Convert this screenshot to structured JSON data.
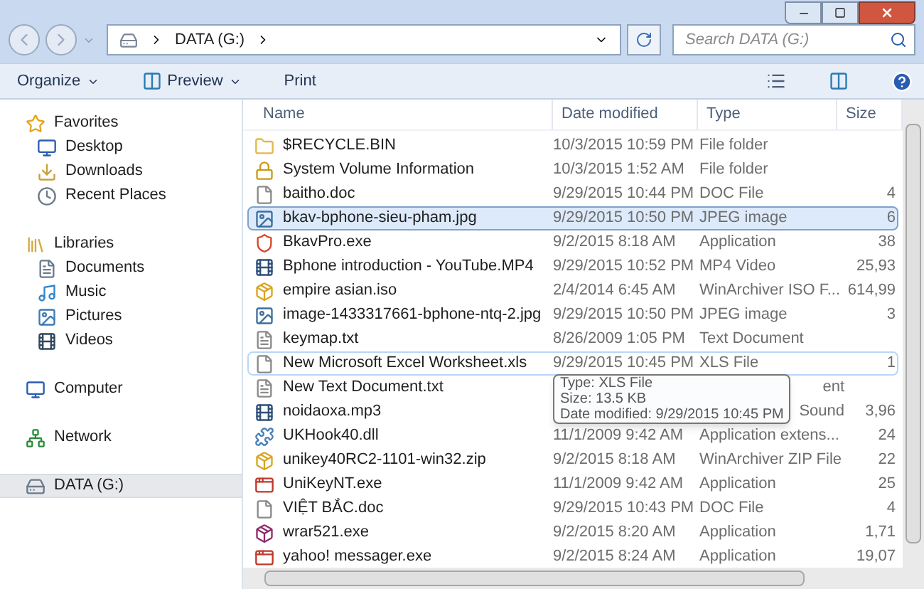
{
  "address": {
    "crumbs": [
      "DATA (G:)"
    ]
  },
  "search": {
    "placeholder": "Search DATA (G:)"
  },
  "toolbar": {
    "buttons": [
      {
        "label": "Organize",
        "kind": "menu"
      },
      {
        "label": "Preview",
        "kind": "preview"
      },
      {
        "label": "Print",
        "kind": "plain"
      }
    ]
  },
  "sidebar": {
    "groups": [
      {
        "label": "Favorites",
        "kind": "star",
        "selected": false,
        "children": [
          {
            "label": "Desktop",
            "kind": "desktop",
            "selected": false
          },
          {
            "label": "Downloads",
            "kind": "downloads",
            "selected": false
          },
          {
            "label": "Recent Places",
            "kind": "recent",
            "selected": false
          }
        ]
      },
      {
        "label": "Libraries",
        "kind": "library",
        "selected": false,
        "children": [
          {
            "label": "Documents",
            "kind": "document",
            "selected": false
          },
          {
            "label": "Music",
            "kind": "music",
            "selected": false
          },
          {
            "label": "Pictures",
            "kind": "picture",
            "selected": false
          },
          {
            "label": "Videos",
            "kind": "video",
            "selected": false
          }
        ]
      },
      {
        "label": "Computer",
        "kind": "computer",
        "selected": false
      },
      {
        "label": "Network",
        "kind": "network",
        "selected": false
      },
      {
        "label": "DATA (G:)",
        "kind": "drive",
        "selected": true
      }
    ]
  },
  "table": {
    "columns": [
      "Name",
      "Date modified",
      "Type",
      "Size"
    ],
    "rows": [
      {
        "kind": "folder",
        "name": "$RECYCLE.BIN",
        "date": "10/3/2015 10:59 PM",
        "type": "File folder",
        "selected": false,
        "hovered": false
      },
      {
        "kind": "locked",
        "name": "System Volume Information",
        "date": "10/3/2015 1:52 AM",
        "type": "File folder",
        "selected": false,
        "hovered": false
      },
      {
        "kind": "doc",
        "name": "baitho.doc",
        "date": "9/29/2015 10:44 PM",
        "type": "DOC File",
        "size": "4",
        "selected": false,
        "hovered": false
      },
      {
        "kind": "image",
        "name": "bkav-bphone-sieu-pham.jpg",
        "date": "9/29/2015 10:50 PM",
        "type": "JPEG image",
        "size": "6",
        "selected": true,
        "hovered": false
      },
      {
        "kind": "shield",
        "name": "BkavPro.exe",
        "date": "9/2/2015 8:18 AM",
        "type": "Application",
        "size": "38",
        "selected": false,
        "hovered": false
      },
      {
        "kind": "media",
        "name": "Bphone introduction - YouTube.MP4",
        "date": "9/29/2015 10:52 PM",
        "type": "MP4 Video",
        "size": "25,93",
        "selected": false,
        "hovered": false
      },
      {
        "kind": "archive",
        "name": "empire asian.iso",
        "date": "2/4/2014 6:45 AM",
        "type": "WinArchiver ISO F...",
        "size": "614,99",
        "selected": false,
        "hovered": false
      },
      {
        "kind": "image",
        "name": "image-1433317661-bphone-ntq-2.jpg",
        "date": "9/29/2015 10:50 PM",
        "type": "JPEG image",
        "size": "3",
        "selected": false,
        "hovered": false
      },
      {
        "kind": "text",
        "name": "keymap.txt",
        "date": "8/26/2009 1:05 PM",
        "type": "Text Document",
        "selected": false,
        "hovered": false
      },
      {
        "kind": "doc",
        "name": "New Microsoft Excel Worksheet.xls",
        "date": "9/29/2015 10:45 PM",
        "type": "XLS File",
        "size": "1",
        "selected": false,
        "hovered": true
      },
      {
        "kind": "text",
        "name": "New Text Document.txt",
        "type": "ent",
        "selected": false,
        "hovered": false
      },
      {
        "kind": "media",
        "name": "noidaoxa.mp3",
        "type": "Sound",
        "size": "3,96",
        "selected": false,
        "hovered": false
      },
      {
        "kind": "dll",
        "name": "UKHook40.dll",
        "date": "11/1/2009 9:42 AM",
        "type": "Application extens...",
        "size": "24",
        "selected": false,
        "hovered": false
      },
      {
        "kind": "archive",
        "name": "unikey40RC2-1101-win32.zip",
        "date": "9/2/2015 8:18 AM",
        "type": "WinArchiver ZIP File",
        "size": "22",
        "selected": false,
        "hovered": false
      },
      {
        "kind": "app",
        "name": "UniKeyNT.exe",
        "date": "11/1/2009 9:42 AM",
        "type": "Application",
        "size": "25",
        "selected": false,
        "hovered": false
      },
      {
        "kind": "doc",
        "name": "VIỆT BẮC.doc",
        "date": "9/29/2015 10:43 PM",
        "type": "DOC File",
        "size": "4",
        "selected": false,
        "hovered": false
      },
      {
        "kind": "rar",
        "name": "wrar521.exe",
        "date": "9/2/2015 8:20 AM",
        "type": "Application",
        "size": "1,71",
        "selected": false,
        "hovered": false
      },
      {
        "kind": "app",
        "name": "yahoo! messager.exe",
        "date": "9/2/2015 8:24 AM",
        "type": "Application",
        "size": "19,07",
        "selected": false,
        "hovered": false
      }
    ]
  },
  "tooltip": {
    "lines": [
      "Type: XLS File",
      "Size: 13.5 KB",
      "Date modified: 9/29/2015 10:45 PM"
    ]
  }
}
